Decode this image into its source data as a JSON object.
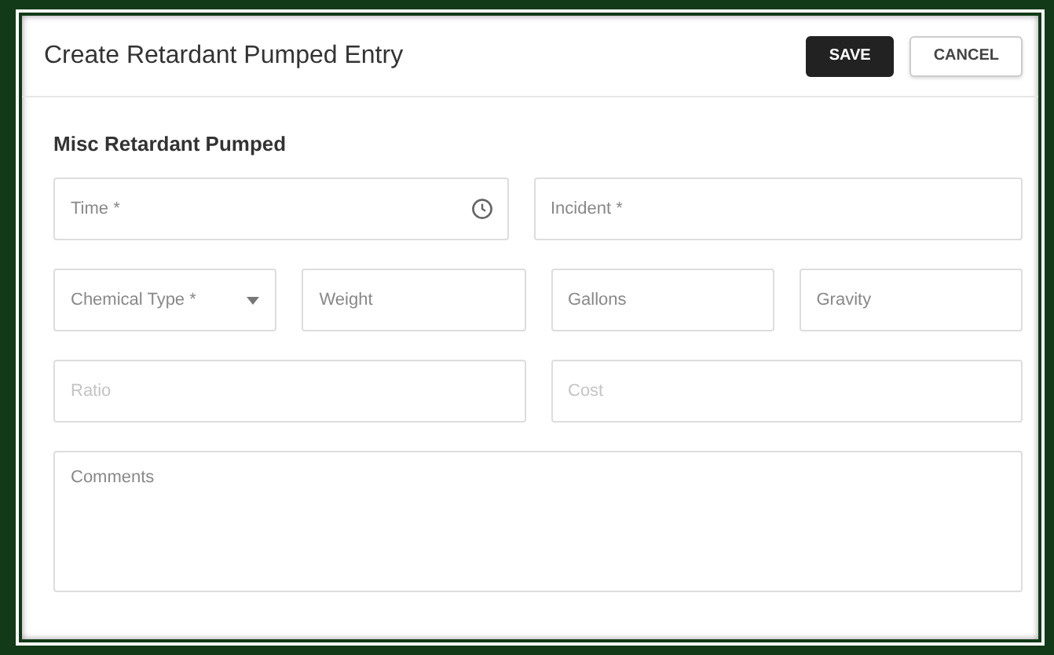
{
  "dialog": {
    "title": "Create Retardant Pumped Entry",
    "buttons": [
      {
        "label": "SAVE",
        "kind": "primary"
      },
      {
        "label": "CANCEL",
        "kind": "secondary"
      }
    ]
  },
  "section": {
    "title": "Misc Retardant Pumped",
    "rows": [
      [
        {
          "kind": "time",
          "placeholder": "Time *",
          "disabled": false
        },
        {
          "kind": "text",
          "placeholder": "Incident *",
          "disabled": false
        }
      ],
      [
        {
          "kind": "select",
          "placeholder": "Chemical Type *",
          "disabled": false
        },
        {
          "kind": "text",
          "placeholder": "Weight",
          "disabled": false
        },
        {
          "kind": "text",
          "placeholder": "Gallons",
          "disabled": false
        },
        {
          "kind": "text",
          "placeholder": "Gravity",
          "disabled": false
        }
      ],
      [
        {
          "kind": "text",
          "placeholder": "Ratio",
          "disabled": true
        },
        {
          "kind": "text",
          "placeholder": "Cost",
          "disabled": true
        }
      ],
      [
        {
          "kind": "textarea",
          "placeholder": "Comments",
          "disabled": false
        }
      ]
    ]
  }
}
